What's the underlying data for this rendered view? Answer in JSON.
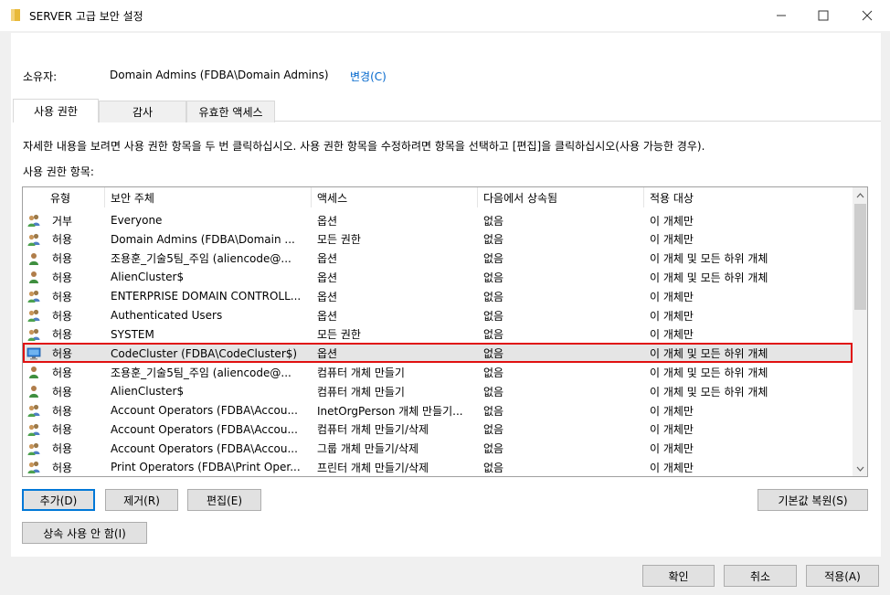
{
  "window": {
    "title": "SERVER 고급 보안 설정",
    "controls": {
      "minimize": "—",
      "maximize": "☐",
      "close": "✕"
    }
  },
  "owner": {
    "label": "소유자:",
    "value": "Domain Admins (FDBA\\Domain Admins)",
    "change_link": "변경(C)"
  },
  "tabs": [
    {
      "label": "사용 권한",
      "active": true
    },
    {
      "label": "감사",
      "active": false
    },
    {
      "label": "유효한 액세스",
      "active": false
    }
  ],
  "description": "자세한 내용을 보려면 사용 권한 항목을 두 번 클릭하십시오. 사용 권한 항목을 수정하려면 항목을 선택하고 [편집]을 클릭하십시오(사용 가능한 경우).",
  "list_label": "사용 권한 항목:",
  "columns": [
    "유형",
    "보안 주체",
    "액세스",
    "다음에서 상속됨",
    "적용 대상"
  ],
  "rows": [
    {
      "icon": "group-icon",
      "type": "거부",
      "principal": "Everyone",
      "access": "옵션",
      "inherited": "없음",
      "applies": "이 개체만"
    },
    {
      "icon": "group-icon",
      "type": "허용",
      "principal": "Domain Admins (FDBA\\Domain ...",
      "access": "모든 권한",
      "inherited": "없음",
      "applies": "이 개체만"
    },
    {
      "icon": "user-icon",
      "type": "허용",
      "principal": "조용훈_기술5팀_주임 (aliencode@...",
      "access": "옵션",
      "inherited": "없음",
      "applies": "이 개체 및 모든 하위 개체"
    },
    {
      "icon": "user-icon",
      "type": "허용",
      "principal": "AlienCluster$",
      "access": "옵션",
      "inherited": "없음",
      "applies": "이 개체 및 모든 하위 개체"
    },
    {
      "icon": "group-icon",
      "type": "허용",
      "principal": "ENTERPRISE DOMAIN CONTROLL...",
      "access": "옵션",
      "inherited": "없음",
      "applies": "이 개체만"
    },
    {
      "icon": "group-icon",
      "type": "허용",
      "principal": "Authenticated Users",
      "access": "옵션",
      "inherited": "없음",
      "applies": "이 개체만"
    },
    {
      "icon": "group-icon",
      "type": "허용",
      "principal": "SYSTEM",
      "access": "모든 권한",
      "inherited": "없음",
      "applies": "이 개체만"
    },
    {
      "icon": "computer-icon",
      "type": "허용",
      "principal": "CodeCluster (FDBA\\CodeCluster$)",
      "access": "옵션",
      "inherited": "없음",
      "applies": "이 개체 및 모든 하위 개체"
    },
    {
      "icon": "user-icon",
      "type": "허용",
      "principal": "조용훈_기술5팀_주임 (aliencode@...",
      "access": "컴퓨터 개체 만들기",
      "inherited": "없음",
      "applies": "이 개체 및 모든 하위 개체"
    },
    {
      "icon": "user-icon",
      "type": "허용",
      "principal": "AlienCluster$",
      "access": "컴퓨터 개체 만들기",
      "inherited": "없음",
      "applies": "이 개체 및 모든 하위 개체"
    },
    {
      "icon": "group-icon",
      "type": "허용",
      "principal": "Account Operators (FDBA\\Accou...",
      "access": "InetOrgPerson 개체 만들기...",
      "inherited": "없음",
      "applies": "이 개체만"
    },
    {
      "icon": "group-icon",
      "type": "허용",
      "principal": "Account Operators (FDBA\\Accou...",
      "access": "컴퓨터 개체 만들기/삭제",
      "inherited": "없음",
      "applies": "이 개체만"
    },
    {
      "icon": "group-icon",
      "type": "허용",
      "principal": "Account Operators (FDBA\\Accou...",
      "access": "그룹 개체 만들기/삭제",
      "inherited": "없음",
      "applies": "이 개체만"
    },
    {
      "icon": "group-icon",
      "type": "허용",
      "principal": "Print Operators (FDBA\\Print Oper...",
      "access": "프린터 개체 만들기/삭제",
      "inherited": "없음",
      "applies": "이 개체만"
    }
  ],
  "buttons": {
    "add": "추가(D)",
    "remove": "제거(R)",
    "edit": "편집(E)",
    "restore_defaults": "기본값 복원(S)",
    "disable_inheritance": "상속 사용 안 함(I)",
    "ok": "확인",
    "cancel": "취소",
    "apply": "적용(A)"
  },
  "colors": {
    "link": "#0066cc",
    "highlight_border": "#e01010",
    "selected_row": "#e5e5e5"
  }
}
